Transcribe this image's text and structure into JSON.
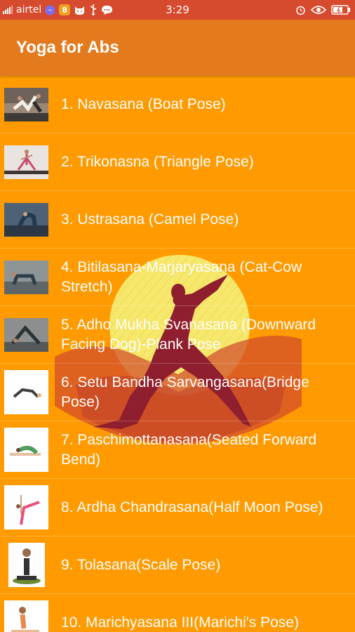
{
  "status_bar": {
    "carrier": "airtel",
    "time": "3:29",
    "icons": [
      "signal-icon",
      "messenger-icon",
      "app-icon",
      "cat-icon",
      "usb-icon",
      "chat-icon",
      "alarm-icon",
      "eye-icon",
      "battery-icon"
    ]
  },
  "app_bar": {
    "title": "Yoga for Abs"
  },
  "poses": [
    {
      "label": "1. Navasana (Boat Pose)",
      "thumb": "boat-pose-photo"
    },
    {
      "label": "2. Trikonasna (Triangle Pose)",
      "thumb": "triangle-pose-photo"
    },
    {
      "label": "3. Ustrasana (Camel Pose)",
      "thumb": "camel-pose-photo"
    },
    {
      "label": "4. Bitilasana-Marjaryasana (Cat-Cow Stretch)",
      "thumb": "cat-cow-photo"
    },
    {
      "label": "5. Adho Mukha Svanasana (Downward Facing Dog)-Plank Pose",
      "thumb": "downward-dog-photo"
    },
    {
      "label": "6. Setu Bandha Sarvangasana(Bridge Pose)",
      "thumb": "bridge-pose-photo"
    },
    {
      "label": "7. Paschimottanasana(Seated Forward Bend)",
      "thumb": "seated-forward-bend-photo"
    },
    {
      "label": "8. Ardha Chandrasana(Half Moon Pose)",
      "thumb": "half-moon-pose-photo"
    },
    {
      "label": "9. Tolasana(Scale Pose)",
      "thumb": "scale-pose-photo"
    },
    {
      "label": "10. Marichyasana III(Marichi's Pose)",
      "thumb": "marichi-pose-photo"
    }
  ],
  "colors": {
    "status_bar": "#d64a2e",
    "app_bar": "#e47a1e",
    "background": "#ff9b00",
    "logo_sun": "#f6ec72",
    "logo_figure": "#8f1f2e",
    "logo_mountain": "#d14b2b"
  }
}
